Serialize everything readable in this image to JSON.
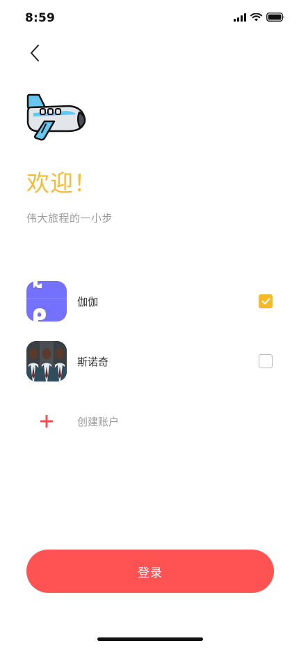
{
  "status_bar": {
    "time": "8:59",
    "icons": [
      "signal-icon",
      "wifi-icon",
      "battery-icon"
    ]
  },
  "header": {
    "back_icon": "chevron-left-icon"
  },
  "logo": {
    "icon": "airplane-icon"
  },
  "welcome": {
    "title": "欢迎！",
    "subtitle": "伟大旅程的一小步"
  },
  "accounts": [
    {
      "name": "伽伽",
      "selected": true,
      "avatar": "avatar-purple"
    },
    {
      "name": "斯诺奇",
      "selected": false,
      "avatar": "avatar-photo"
    }
  ],
  "create_account": {
    "label": "创建账户",
    "icon": "plus-icon"
  },
  "login": {
    "label": "登录"
  },
  "colors": {
    "accent_yellow": "#f6bc37",
    "checkbox_yellow": "#f7b928",
    "primary_red": "#ff5252",
    "avatar_purple": "#7471ff",
    "muted_text": "#9a9a9a"
  }
}
